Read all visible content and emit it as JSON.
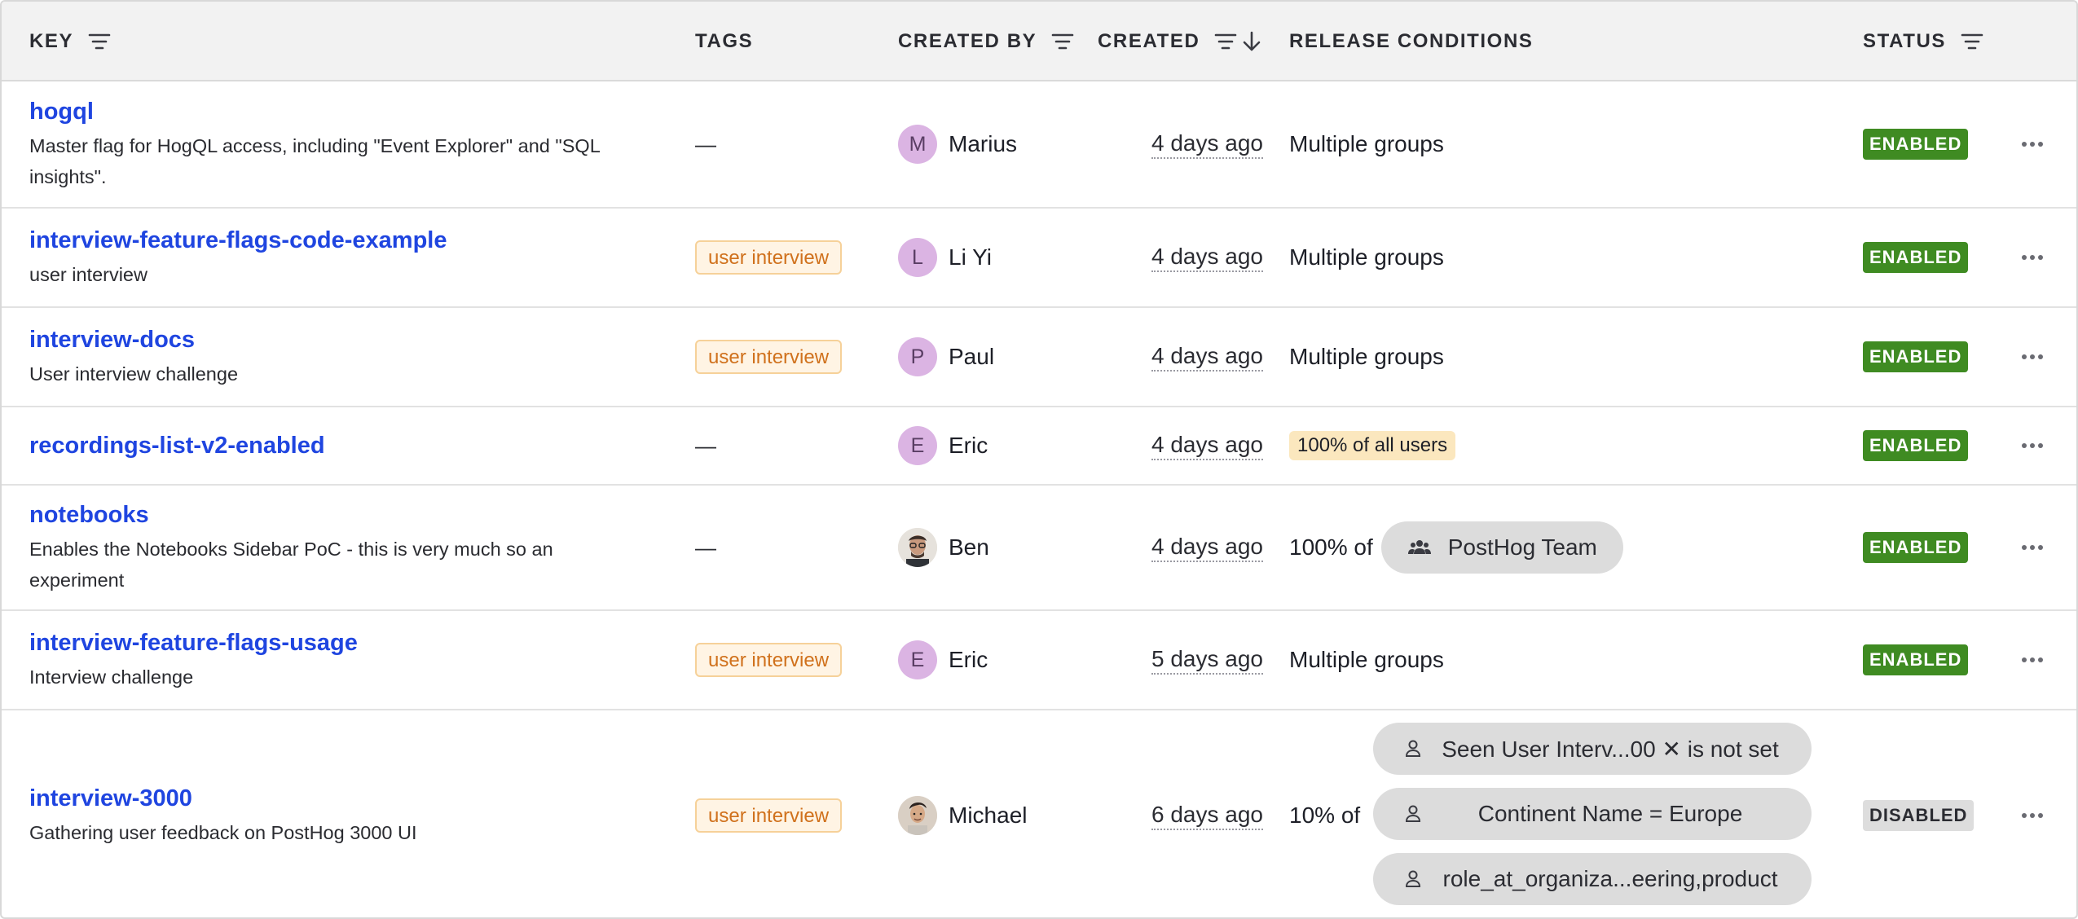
{
  "header": {
    "key": "KEY",
    "tags": "TAGS",
    "created_by": "CREATED BY",
    "created": "CREATED",
    "release_conditions": "RELEASE CONDITIONS",
    "status": "STATUS"
  },
  "rows": [
    {
      "key": "hogql",
      "description": "Master flag for HogQL access, including \"Event Explorer\" and \"SQL insights\".",
      "tag": "—",
      "creator_initial": "M",
      "creator": "Marius",
      "created": "4 days ago",
      "release": "Multiple groups",
      "status": "ENABLED"
    },
    {
      "key": "interview-feature-flags-code-example",
      "description": "user interview",
      "tag": "user interview",
      "creator_initial": "L",
      "creator": "Li Yi",
      "created": "4 days ago",
      "release": "Multiple groups",
      "status": "ENABLED"
    },
    {
      "key": "interview-docs",
      "description": "User interview challenge",
      "tag": "user interview",
      "creator_initial": "P",
      "creator": "Paul",
      "created": "4 days ago",
      "release": "Multiple groups",
      "status": "ENABLED"
    },
    {
      "key": "recordings-list-v2-enabled",
      "description": "",
      "tag": "—",
      "creator_initial": "E",
      "creator": "Eric",
      "created": "4 days ago",
      "release": "100% of all users",
      "status": "ENABLED"
    },
    {
      "key": "notebooks",
      "description": "Enables the Notebooks Sidebar PoC - this is very much so an experiment",
      "tag": "—",
      "creator_initial": "",
      "creator": "Ben",
      "created": "4 days ago",
      "release_prefix": "100% of",
      "release_group": "PostHog Team",
      "status": "ENABLED"
    },
    {
      "key": "interview-feature-flags-usage",
      "description": "Interview challenge",
      "tag": "user interview",
      "creator_initial": "E",
      "creator": "Eric",
      "created": "5 days ago",
      "release": "Multiple groups",
      "status": "ENABLED"
    },
    {
      "key": "interview-3000",
      "description": "Gathering user feedback on PostHog 3000 UI",
      "tag": "user interview",
      "creator_initial": "",
      "creator": "Michael",
      "created": "6 days ago",
      "release_prefix": "10% of",
      "conditions": [
        "Seen User Interv...00 ✕ is not set",
        "Continent Name = Europe",
        "role_at_organiza...eering,product"
      ],
      "status": "DISABLED"
    }
  ],
  "colors": {
    "link": "#1f45e0",
    "enabled": "#3f8b22",
    "disabled": "#dddddd",
    "tag_text": "#d0711c",
    "avatar": "#dbb4e3"
  },
  "icons": {
    "sort": "sort-icon",
    "sort_desc": "arrow-down-icon",
    "group": "group-icon",
    "person": "person-icon",
    "more": "more-icon"
  }
}
